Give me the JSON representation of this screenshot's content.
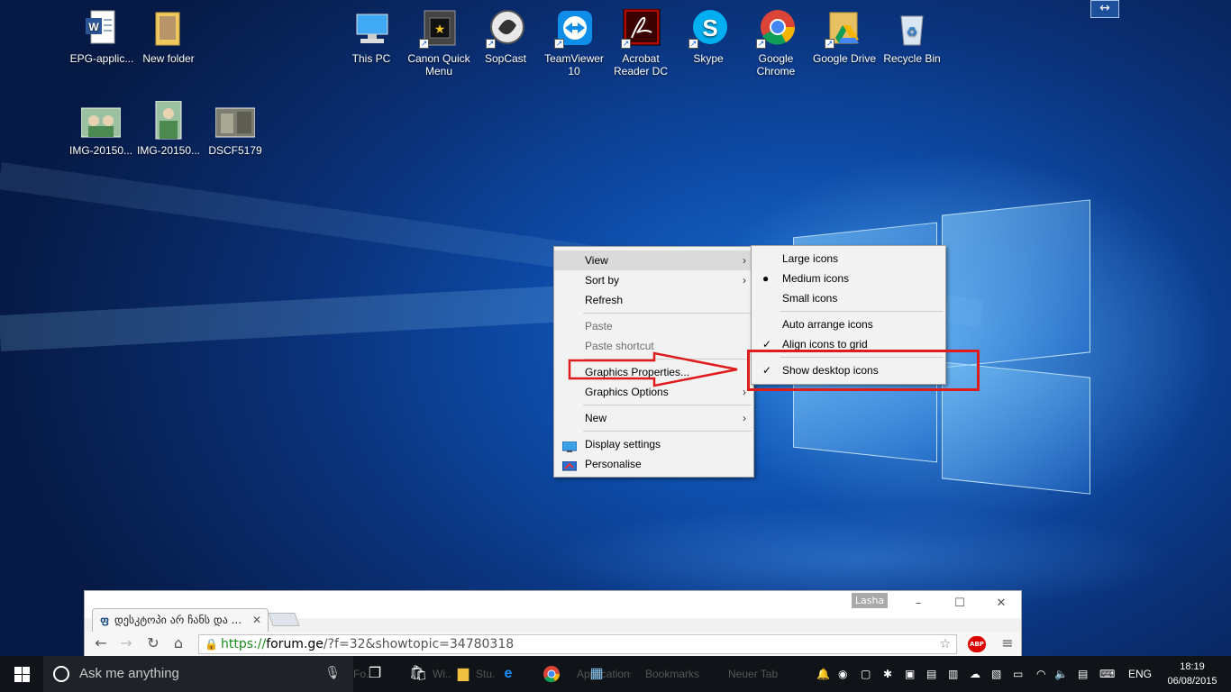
{
  "desktop": {
    "icons_row1_left": [
      {
        "label": "EPG-applic...",
        "icon": "word-document-icon"
      },
      {
        "label": "New folder",
        "icon": "folder-icon"
      }
    ],
    "icons_row1_right": [
      {
        "label": "This PC",
        "icon": "computer-icon"
      },
      {
        "label": "Canon Quick Menu",
        "icon": "canon-quick-menu-icon"
      },
      {
        "label": "SopCast",
        "icon": "sopcast-icon"
      },
      {
        "label": "TeamViewer 10",
        "icon": "teamviewer-icon"
      },
      {
        "label": "Acrobat Reader DC",
        "icon": "acrobat-icon"
      },
      {
        "label": "Skype",
        "icon": "skype-icon"
      },
      {
        "label": "Google Chrome",
        "icon": "chrome-icon"
      },
      {
        "label": "Google Drive",
        "icon": "google-drive-icon"
      },
      {
        "label": "Recycle Bin",
        "icon": "recycle-bin-icon"
      }
    ],
    "icons_row2": [
      {
        "label": "IMG-20150...",
        "icon": "image-icon"
      },
      {
        "label": "IMG-20150...",
        "icon": "image-icon"
      },
      {
        "label": "DSCF5179",
        "icon": "image-icon"
      }
    ],
    "resize_glyph": "↔"
  },
  "context_menu": {
    "items": [
      {
        "label": "View",
        "submenu": true
      },
      {
        "label": "Sort by",
        "submenu": true
      },
      {
        "label": "Refresh"
      },
      {
        "label": "Paste",
        "disabled": true
      },
      {
        "label": "Paste shortcut",
        "disabled": true
      },
      {
        "label": "Graphics Properties..."
      },
      {
        "label": "Graphics Options",
        "submenu": true
      },
      {
        "label": "New",
        "submenu": true
      },
      {
        "label": "Display settings",
        "icon": "display-settings-icon"
      },
      {
        "label": "Personalise",
        "icon": "personalise-icon"
      }
    ]
  },
  "view_submenu": {
    "items": [
      {
        "label": "Large icons"
      },
      {
        "label": "Medium icons",
        "mark": "●"
      },
      {
        "label": "Small icons"
      },
      {
        "label": "Auto arrange icons"
      },
      {
        "label": "Align icons to grid",
        "mark": "✓"
      },
      {
        "label": "Show desktop icons",
        "mark": "✓"
      }
    ]
  },
  "browser": {
    "user": "Lasha",
    "tab_title": "დესკტოპი არ ჩანს და ...",
    "tab_favicon": "ფ",
    "url_scheme": "https://",
    "url_host": "forum.ge",
    "url_rest": "/?f=32&showtopic=34780318",
    "abp_label": "ABP",
    "controls": {
      "minimize": "–",
      "maximize": "☐",
      "close": "✕"
    }
  },
  "taskbar": {
    "search_placeholder": "Ask me anything",
    "items": [
      "Fo...",
      "Wi...",
      "Stu..."
    ],
    "chrome_items": [
      "Applications",
      "Bookmarks",
      "Neuer Tab"
    ],
    "language": "ENG",
    "time": "18:19",
    "date": "06/08/2015"
  },
  "colors": {
    "annotation_red": "#e01b1b",
    "taskbar_bg": "#101317"
  }
}
